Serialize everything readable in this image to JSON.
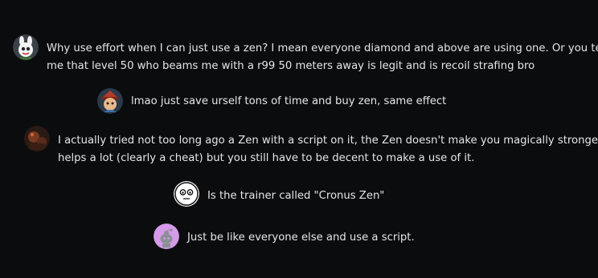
{
  "comments": [
    {
      "avatar_icon": "bunny-avatar-icon",
      "lines": [
        "Why use effort when I can just use a zen? I mean everyone diamond and above are using one. Or you telling",
        "me that level 50 who beams me with a r99 50 meters away is legit and is recoil strafing bro"
      ]
    },
    {
      "avatar_icon": "hat-character-avatar-icon",
      "lines": [
        "lmao just save urself tons of time and buy zen, same effect"
      ]
    },
    {
      "avatar_icon": "dark-photo-avatar-icon",
      "lines": [
        "I actually tried not too long ago a Zen with a script on it, the Zen doesn't make you magically stronger, it",
        "helps a lot (clearly a cheat) but you still have to be decent to make a use of it."
      ]
    },
    {
      "avatar_icon": "cartoon-face-avatar-icon",
      "lines": [
        "Is the trainer called \"Cronus Zen\""
      ]
    },
    {
      "avatar_icon": "default-snoo-avatar-icon",
      "lines": [
        "Just be like everyone else and use a script."
      ]
    }
  ]
}
